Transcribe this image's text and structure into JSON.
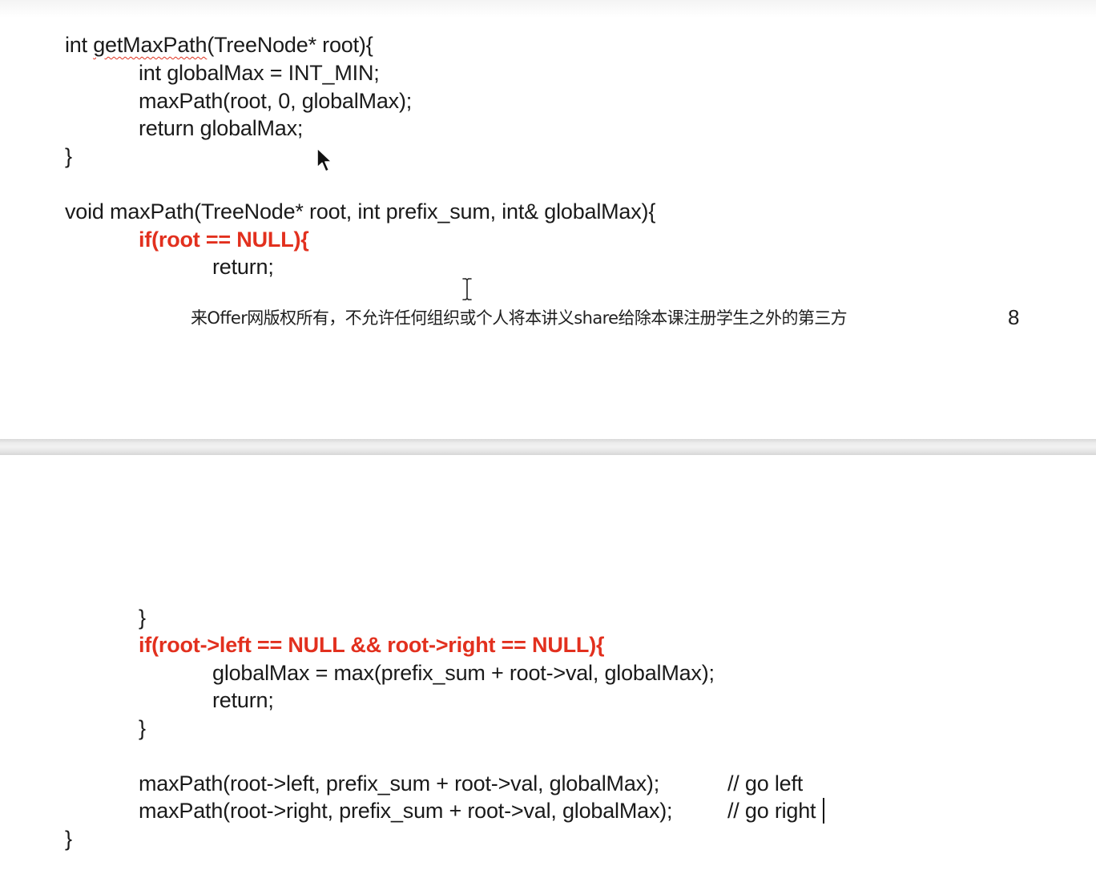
{
  "slide_top": {
    "lines": [
      {
        "before": "int ",
        "fn": "getMaxPath",
        "after": "(TreeNode* root){"
      },
      {
        "text": "int globalMax = INT_MIN;"
      },
      {
        "text": "maxPath(root, 0, globalMax);"
      },
      {
        "text": "return globalMax;"
      },
      {
        "text": "}"
      },
      {
        "text": "void maxPath(TreeNode* root, int prefix_sum, int& globalMax){"
      },
      {
        "text": "if(root == NULL){"
      },
      {
        "text": "return;"
      }
    ],
    "footer_note": "来Offer网版权所有，不允许任何组织或个人将本讲义share给除本课注册学生之外的第三方",
    "page_number": "8"
  },
  "slide_bottom": {
    "lines": [
      {
        "text": "}"
      },
      {
        "text": "if(root->left == NULL && root->right == NULL){"
      },
      {
        "text": "globalMax = max(prefix_sum + root->val, globalMax);"
      },
      {
        "text": "return;"
      },
      {
        "text": "}"
      },
      {
        "code": "maxPath(root->left, prefix_sum + root->val, globalMax);",
        "comment": "// go left"
      },
      {
        "code": "maxPath(root->right, prefix_sum + root->val, globalMax);",
        "comment": "// go right"
      },
      {
        "text": "}"
      }
    ]
  },
  "colors": {
    "highlight_red": "#e2301e",
    "text": "#1a1a1a",
    "spell_underline": "#e0321f"
  },
  "icons": [
    "mouse-pointer-arrow-icon",
    "text-ibeam-cursor-icon",
    "text-caret"
  ]
}
